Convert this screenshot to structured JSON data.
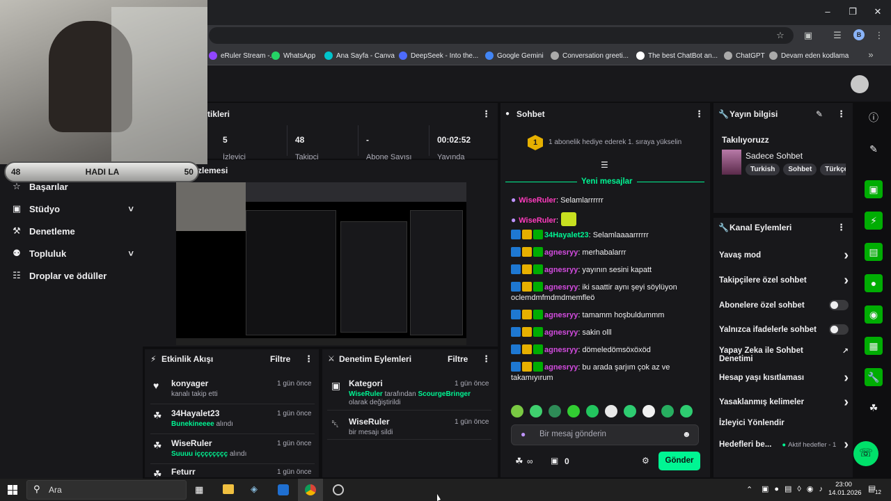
{
  "bookmarks": [
    {
      "label": "eRuler Stream -...",
      "icon": "twitch-icon",
      "color": "#9146ff"
    },
    {
      "label": "WhatsApp",
      "icon": "whatsapp-icon",
      "color": "#25d366"
    },
    {
      "label": "Ana Sayfa - Canva",
      "icon": "canva-icon",
      "color": "#00c4cc"
    },
    {
      "label": "DeepSeek - Into the...",
      "icon": "deepseek-icon",
      "color": "#4d6bfe"
    },
    {
      "label": "Google Gemini",
      "icon": "gemini-icon",
      "color": "#4285f4"
    },
    {
      "label": "Conversation greeti...",
      "icon": "chatgpt-icon",
      "color": "#aaaaaa"
    },
    {
      "label": "The best ChatBot an...",
      "icon": "chatbot-icon",
      "color": "#ffffff"
    },
    {
      "label": "ChatGPT",
      "icon": "chatgpt-icon",
      "color": "#aaaaaa"
    },
    {
      "label": "Devam eden kodlama",
      "icon": "chatgpt-icon",
      "color": "#aaaaaa"
    }
  ],
  "profile_initial": "B",
  "overlay": {
    "left_num": "48",
    "text": "HADI LA",
    "right_num": "50"
  },
  "stats": {
    "title_fragment": "tikleri",
    "items": [
      {
        "value": "5",
        "label": "İzleyici"
      },
      {
        "value": "48",
        "label": "Takipçi"
      },
      {
        "value": "-",
        "label": "Abone Sayısı"
      },
      {
        "value": "00:02:52",
        "label": "Yayında"
      }
    ]
  },
  "preview_title_fragment": "zlemesi",
  "nav": {
    "items": [
      {
        "label": "Başarılar",
        "icon": "trophy-icon",
        "chevron": false
      },
      {
        "label": "Stüdyo",
        "icon": "studio-icon",
        "chevron": true
      },
      {
        "label": "Denetleme",
        "icon": "wrench-icon",
        "chevron": false
      },
      {
        "label": "Topluluk",
        "icon": "community-icon",
        "chevron": true
      },
      {
        "label": "Droplar ve ödüller",
        "icon": "gift-icon",
        "chevron": false
      }
    ]
  },
  "activity": {
    "title": "Etkinlik Akışı",
    "filter": "Filtre",
    "rows": [
      {
        "name": "konyager",
        "sub_green": "",
        "sub": "kanalı takip etti",
        "ago": "1 gün önce",
        "icon": "heart-icon"
      },
      {
        "name": "34Hayalet23",
        "sub_green": "Bunekineeee",
        "sub": "alındı",
        "ago": "1 gün önce",
        "icon": "channel-points-icon"
      },
      {
        "name": "WiseRuler",
        "sub_green": "Suuuu içççççççç",
        "sub": "alındı",
        "ago": "1 gün önce",
        "icon": "channel-points-icon"
      },
      {
        "name": "Feturr",
        "sub_green": "",
        "sub": "",
        "ago": "1 gün önce",
        "icon": "channel-points-icon"
      }
    ]
  },
  "moderation": {
    "title": "Denetim Eylemleri",
    "filter": "Filtre",
    "rows": [
      {
        "name": "Kategori",
        "line1_user": "WiseRuler",
        "line1_mid": "tarafından",
        "line1_user2": "ScourgeBringer",
        "line2": "olarak değiştirildi",
        "ago": "1 gün önce",
        "icon": "category-icon"
      },
      {
        "name": "WiseRuler",
        "line1_user": "",
        "line1_mid": "",
        "line1_user2": "",
        "line2": "bir mesajı sildi",
        "ago": "1 gün önce",
        "icon": "trash-icon"
      }
    ]
  },
  "chat": {
    "title": "Sohbet",
    "gift_rank": "1",
    "gift_text": "1 abonelik hediye ederek 1. sıraya yükselin",
    "new_messages": "Yeni mesajlar",
    "messages": [
      {
        "badges": [
          "mic"
        ],
        "user": "WiseRuler",
        "cls": "u-pink",
        "text": ": Selamlarrrrrr"
      },
      {
        "badges": [
          "mic"
        ],
        "user": "WiseRuler",
        "cls": "u-pink",
        "text": ":"
      },
      {
        "badges": [
          "blue",
          "sub",
          "mod"
        ],
        "user": "34Hayalet23",
        "cls": "u-grn",
        "text": ": Selamlaaaarrrrrr"
      },
      {
        "badges": [
          "blue",
          "sub",
          "mod"
        ],
        "user": "agnesryy",
        "cls": "u-mag",
        "text": ": merhabalarrr"
      },
      {
        "badges": [
          "blue",
          "sub",
          "mod"
        ],
        "user": "agnesryy",
        "cls": "u-mag",
        "text": ": yayının sesini kapatt"
      },
      {
        "badges": [
          "blue",
          "sub",
          "mod"
        ],
        "user": "agnesryy",
        "cls": "u-mag",
        "text": ": iki saattir aynı şeyi söylüyon oclemdmfmdmdmemfleö"
      },
      {
        "badges": [
          "blue",
          "sub",
          "mod"
        ],
        "user": "agnesryy",
        "cls": "u-mag",
        "text": ": tamamm hoşbuldummm"
      },
      {
        "badges": [
          "blue",
          "sub",
          "mod"
        ],
        "user": "agnesryy",
        "cls": "u-mag",
        "text": ": sakin olll"
      },
      {
        "badges": [
          "blue",
          "sub",
          "mod"
        ],
        "user": "agnesryy",
        "cls": "u-mag",
        "text": ": dömeledömsöxöxöd"
      },
      {
        "badges": [
          "blue",
          "sub",
          "mod"
        ],
        "user": "agnesryy",
        "cls": "u-mag",
        "text": ": bu arada şarjım çok az ve takamıyırum"
      }
    ],
    "input_placeholder": "Bir mesaj gönderin",
    "points": "0",
    "send": "Gönder"
  },
  "stream_info": {
    "title": "Yayın bilgisi",
    "stream_title": "Takılıyoruzz",
    "category": "Sadece Sohbet",
    "tags": [
      "Turkish",
      "Sohbet",
      "Türkçe"
    ]
  },
  "channel_actions": {
    "title": "Kanal Eylemleri",
    "items": [
      {
        "label": "Yavaş mod",
        "control": "chevron"
      },
      {
        "label": "Takipçilere özel sohbet",
        "control": "chevron"
      },
      {
        "label": "Abonelere özel sohbet",
        "control": "toggle"
      },
      {
        "label": "Yalnızca ifadelerle sohbet",
        "control": "toggle"
      },
      {
        "label": "Yapay Zeka ile Sohbet Denetimi",
        "control": "external"
      },
      {
        "label": "Hesap yaşı kısıtlaması",
        "control": "chevron"
      },
      {
        "label": "Yasaklanmış kelimeler",
        "control": "chevron"
      },
      {
        "label": "İzleyici Yönlendir",
        "control": "none"
      },
      {
        "label": "Hedefleri be...",
        "control": "chevron",
        "extra": "Aktif hedefler - 1"
      }
    ]
  },
  "taskbar": {
    "search": "Ara",
    "time": "23:00",
    "date": "14.01.2026",
    "notif": "12"
  }
}
